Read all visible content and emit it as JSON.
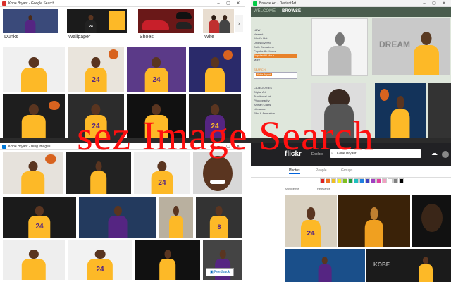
{
  "google": {
    "title": "Kobe Bryant - Google Search",
    "categories": [
      "Dunks",
      "Wallpaper",
      "Shoes",
      "Wife"
    ]
  },
  "deviantart": {
    "title": "Browse Art - DeviantArt",
    "tabs": [
      "WELCOME",
      "BROWSE"
    ],
    "sections": [
      {
        "heading": "",
        "items": [
          "NEW",
          "Newest",
          "What's Hot",
          "Undiscovered",
          "Daily Deviations",
          "Popular 8h Hours",
          "Popular All Hour",
          "More"
        ]
      },
      {
        "heading": "SEARCH",
        "items": []
      },
      {
        "heading": "CATEGORIES",
        "items": [
          "Digital Art",
          "Traditional Art",
          "Photography",
          "Artisan Crafts",
          "Literature",
          "Film & Animation"
        ]
      }
    ],
    "active_item": "Popular All Hour",
    "search_value": "Kobe Bryant",
    "accent": "#89c540"
  },
  "bing": {
    "title": "Kobe Bryant - Bing images",
    "feedback": "Feedback"
  },
  "flickr": {
    "logo": "flickr",
    "nav_explore": "Explore",
    "search_value": "Kobe Bryant",
    "tabs": [
      "Photos",
      "People",
      "Groups"
    ],
    "active_tab": "Photos",
    "filter_license": "Any license",
    "filter_sort": "Relevance",
    "swatches": [
      "#e02020",
      "#f07020",
      "#f0c020",
      "#f0f020",
      "#80c020",
      "#20a040",
      "#20c0c0",
      "#2080e0",
      "#4040c0",
      "#a040c0",
      "#e040a0",
      "#f0a0c0",
      "#ffffff",
      "#808080",
      "#000000"
    ]
  },
  "overlay_text": "sez Image Search"
}
